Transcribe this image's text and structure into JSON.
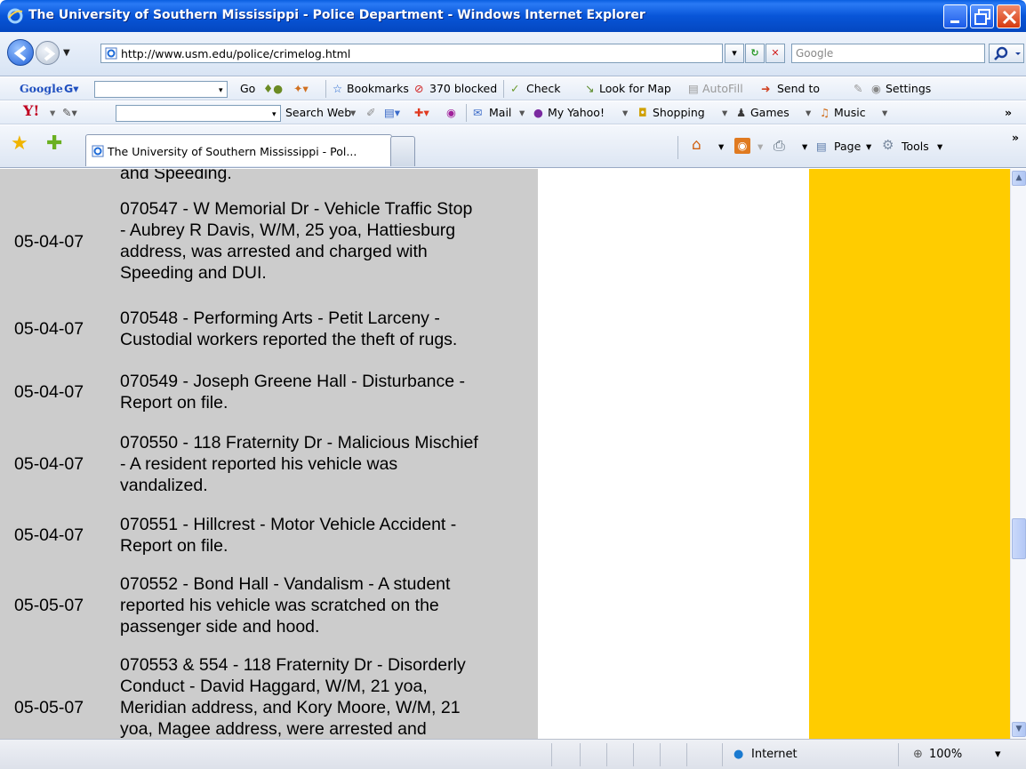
{
  "window": {
    "title": "The University of Southern Mississippi - Police Department - Windows Internet Explorer"
  },
  "nav": {
    "url": "http://www.usm.edu/police/crimelog.html",
    "search_placeholder": "Google"
  },
  "google_toolbar": {
    "logo": "Google",
    "go": "Go",
    "bookmarks": "Bookmarks",
    "blocked": "370 blocked",
    "check": "Check",
    "look_for_map": "Look for Map",
    "autofill": "AutoFill",
    "send_to": "Send to",
    "settings": "Settings"
  },
  "yahoo_toolbar": {
    "logo": "Y!",
    "search_web": "Search Web",
    "mail": "Mail",
    "my_yahoo": "My Yahoo!",
    "shopping": "Shopping",
    "games": "Games",
    "music": "Music"
  },
  "command_bar": {
    "tab_title": "The University of Southern Mississippi - Pol...",
    "page": "Page",
    "tools": "Tools"
  },
  "crime_log": {
    "top_fragment": "and Speeding.",
    "entries": [
      {
        "date": "05-04-07",
        "desc": "070547 - W Memorial Dr - Vehicle Traffic Stop\n- Aubrey R Davis, W/M, 25 yoa, Hattiesburg\naddress, was arrested and charged with\nSpeeding and DUI."
      },
      {
        "date": "05-04-07",
        "desc": "070548 - Performing Arts - Petit Larceny -\nCustodial workers reported the theft of rugs."
      },
      {
        "date": "05-04-07",
        "desc": "070549 - Joseph Greene Hall - Disturbance -\nReport on file."
      },
      {
        "date": "05-04-07",
        "desc": "070550 - 118 Fraternity Dr - Malicious Mischief\n- A resident reported his vehicle was\nvandalized."
      },
      {
        "date": "05-04-07",
        "desc": "070551 - Hillcrest - Motor Vehicle Accident -\nReport on file."
      },
      {
        "date": "05-05-07",
        "desc": "070552 - Bond Hall - Vandalism - A student\nreported his vehicle was scratched on the\npassenger side and hood."
      },
      {
        "date": "05-05-07",
        "desc": "070553 & 554 - 118 Fraternity Dr - Disorderly\nConduct - David Haggard, W/M, 21 yoa,\nMeridian address, and Kory Moore, W/M, 21\nyoa, Magee address, were arrested and"
      }
    ]
  },
  "status": {
    "zone": "Internet",
    "zoom": "100%"
  },
  "colors": {
    "title_bar": "#0855d8",
    "log_column": "#cccccc",
    "right_column": "#ffcc00"
  }
}
